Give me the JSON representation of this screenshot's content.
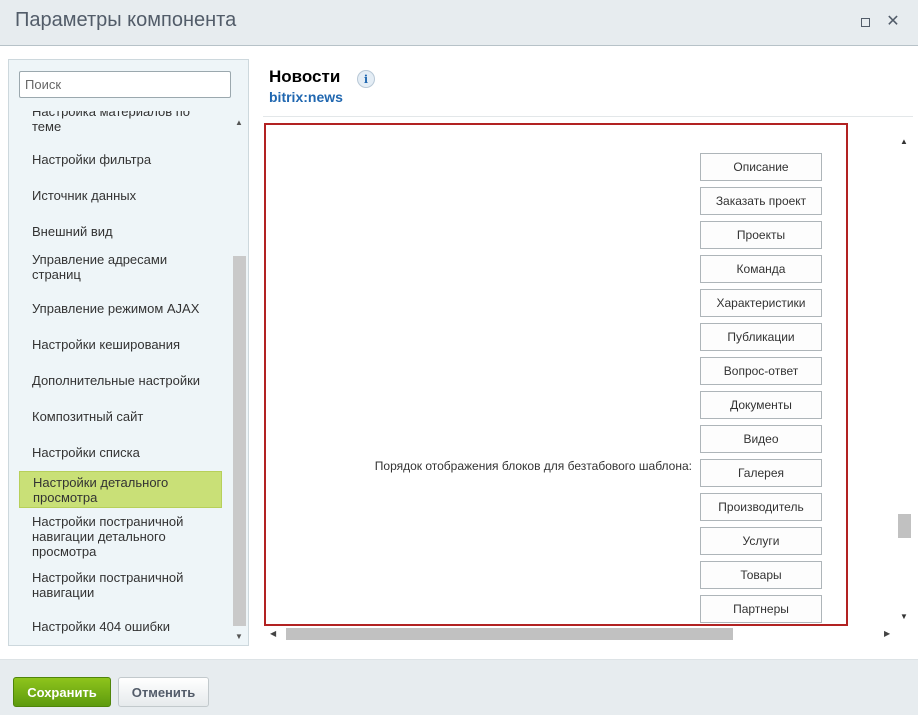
{
  "window": {
    "title": "Параметры компонента",
    "maximize_icon": "maximize-icon",
    "close_icon": "close-icon",
    "close_glyph": "✕"
  },
  "sidebar": {
    "search_placeholder": "Поиск",
    "items": [
      {
        "label": "Настройка материалов по теме",
        "active": false
      },
      {
        "label": "Настройки фильтра",
        "active": false
      },
      {
        "label": "Источник данных",
        "active": false
      },
      {
        "label": "Внешний вид",
        "active": false
      },
      {
        "label": "Управление адресами страниц",
        "active": false
      },
      {
        "label": "Управление режимом AJAX",
        "active": false
      },
      {
        "label": "Настройки кеширования",
        "active": false
      },
      {
        "label": "Дополнительные настройки",
        "active": false
      },
      {
        "label": "Композитный сайт",
        "active": false
      },
      {
        "label": "Настройки списка",
        "active": false
      },
      {
        "label": "Настройки детального просмотра",
        "active": true
      },
      {
        "label": "Настройки постраничной навигации детального просмотра",
        "active": false
      },
      {
        "label": "Настройки постраничной навигации",
        "active": false
      },
      {
        "label": "Настройки 404 ошибки",
        "active": false
      }
    ]
  },
  "component": {
    "name": "Новости",
    "code": "bitrix:news",
    "info_glyph": "i"
  },
  "content": {
    "param_label": "Порядок отображения блоков для безтабового шаблона:",
    "order_buttons": [
      "Описание",
      "Заказать проект",
      "Проекты",
      "Команда",
      "Характеристики",
      "Публикации",
      "Вопрос-ответ",
      "Документы",
      "Видео",
      "Галерея",
      "Производитель",
      "Услуги",
      "Товары",
      "Партнеры"
    ]
  },
  "footer": {
    "save_label": "Сохранить",
    "cancel_label": "Отменить"
  },
  "colors": {
    "accent_active": "#c9e077",
    "content_border": "#b22222",
    "save_button": "#6aa512",
    "link": "#2067b0"
  }
}
